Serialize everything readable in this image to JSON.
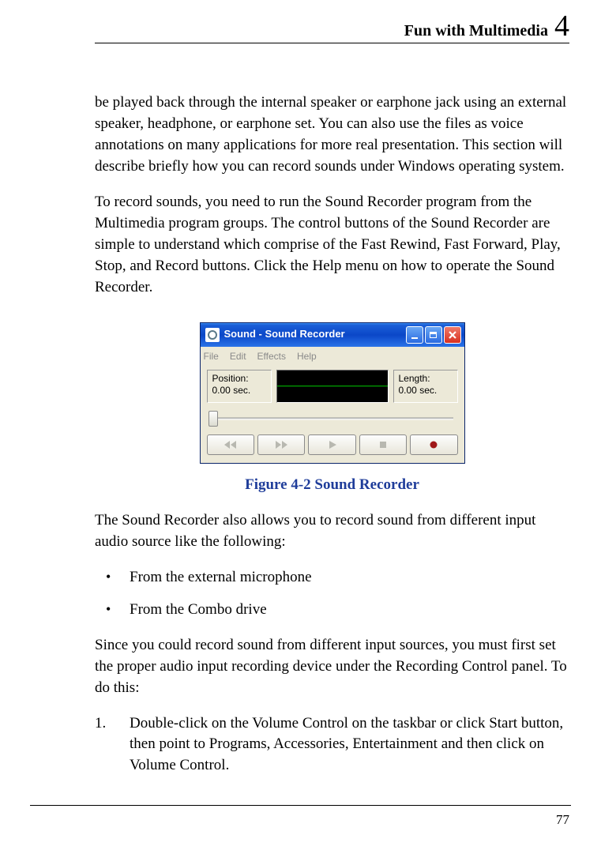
{
  "header": {
    "title": "Fun with Multimedia",
    "chapter": "4"
  },
  "para1": "be played back through the internal speaker or earphone jack using an external speaker, headphone, or earphone set. You can also use the files as voice annotations on many applications for more real presentation. This section will describe briefly how you can record sounds under Windows operating system.",
  "para2": "To record sounds, you need to run the Sound Recorder program from the Multimedia program groups. The control buttons of the Sound Recorder are simple to understand which comprise of the Fast Rewind, Fast Forward, Play, Stop, and Record buttons. Click the Help menu on how to operate the Sound Recorder.",
  "figure": {
    "caption": "Figure 4-2    Sound Recorder",
    "window": {
      "title": "Sound - Sound Recorder",
      "menu": [
        "File",
        "Edit",
        "Effects",
        "Help"
      ],
      "position_label": "Position:",
      "position_value": "0.00 sec.",
      "length_label": "Length:",
      "length_value": "0.00 sec."
    }
  },
  "para3": "The Sound Recorder also allows you to record sound from different input audio source like the following:",
  "bullets": [
    "From the external microphone",
    "From the Combo drive"
  ],
  "para4": "Since you could record sound from different input sources, you must first set the proper audio input recording device under the Recording Control panel. To do this:",
  "steps": [
    {
      "num": "1.",
      "text": "Double-click on the Volume Control on the taskbar or click Start button, then point to Programs, Accessories, Entertainment and then click on Volume Control."
    }
  ],
  "page_number": "77"
}
